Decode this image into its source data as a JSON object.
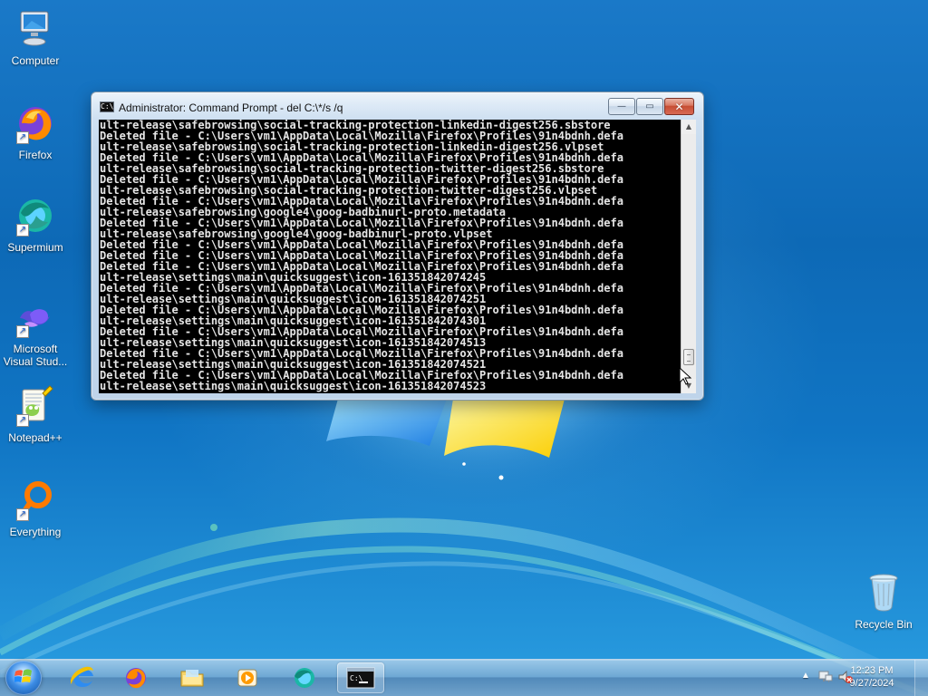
{
  "desktop": {
    "icons": [
      {
        "label": "Computer"
      },
      {
        "label": "Firefox"
      },
      {
        "label": "Supermium"
      },
      {
        "label": "Microsoft Visual Stud..."
      },
      {
        "label": "Notepad++"
      },
      {
        "label": "Everything"
      },
      {
        "label": "Recycle Bin"
      }
    ]
  },
  "cmd_window": {
    "title": "Administrator:  Command Prompt - del  C:\\*/s /q",
    "lines": [
      "ult-release\\safebrowsing\\social-tracking-protection-linkedin-digest256.sbstore",
      "Deleted file - C:\\Users\\vm1\\AppData\\Local\\Mozilla\\Firefox\\Profiles\\91n4bdnh.defa",
      "ult-release\\safebrowsing\\social-tracking-protection-linkedin-digest256.vlpset",
      "Deleted file - C:\\Users\\vm1\\AppData\\Local\\Mozilla\\Firefox\\Profiles\\91n4bdnh.defa",
      "ult-release\\safebrowsing\\social-tracking-protection-twitter-digest256.sbstore",
      "Deleted file - C:\\Users\\vm1\\AppData\\Local\\Mozilla\\Firefox\\Profiles\\91n4bdnh.defa",
      "ult-release\\safebrowsing\\social-tracking-protection-twitter-digest256.vlpset",
      "Deleted file - C:\\Users\\vm1\\AppData\\Local\\Mozilla\\Firefox\\Profiles\\91n4bdnh.defa",
      "ult-release\\safebrowsing\\google4\\goog-badbinurl-proto.metadata",
      "Deleted file - C:\\Users\\vm1\\AppData\\Local\\Mozilla\\Firefox\\Profiles\\91n4bdnh.defa",
      "ult-release\\safebrowsing\\google4\\goog-badbinurl-proto.vlpset",
      "Deleted file - C:\\Users\\vm1\\AppData\\Local\\Mozilla\\Firefox\\Profiles\\91n4bdnh.defa",
      "Deleted file - C:\\Users\\vm1\\AppData\\Local\\Mozilla\\Firefox\\Profiles\\91n4bdnh.defa",
      "Deleted file - C:\\Users\\vm1\\AppData\\Local\\Mozilla\\Firefox\\Profiles\\91n4bdnh.defa",
      "ult-release\\settings\\main\\quicksuggest\\icon-161351842074245",
      "Deleted file - C:\\Users\\vm1\\AppData\\Local\\Mozilla\\Firefox\\Profiles\\91n4bdnh.defa",
      "ult-release\\settings\\main\\quicksuggest\\icon-161351842074251",
      "Deleted file - C:\\Users\\vm1\\AppData\\Local\\Mozilla\\Firefox\\Profiles\\91n4bdnh.defa",
      "ult-release\\settings\\main\\quicksuggest\\icon-161351842074301",
      "Deleted file - C:\\Users\\vm1\\AppData\\Local\\Mozilla\\Firefox\\Profiles\\91n4bdnh.defa",
      "ult-release\\settings\\main\\quicksuggest\\icon-161351842074513",
      "Deleted file - C:\\Users\\vm1\\AppData\\Local\\Mozilla\\Firefox\\Profiles\\91n4bdnh.defa",
      "ult-release\\settings\\main\\quicksuggest\\icon-161351842074521",
      "Deleted file - C:\\Users\\vm1\\AppData\\Local\\Mozilla\\Firefox\\Profiles\\91n4bdnh.defa",
      "ult-release\\settings\\main\\quicksuggest\\icon-161351842074523"
    ],
    "scroll_position": 0.94
  },
  "taskbar": {
    "clock_time": "12:23 PM",
    "clock_date": "9/27/2024"
  },
  "colors": {
    "console_bg": "#000000",
    "console_fg": "#e6e6e6"
  }
}
